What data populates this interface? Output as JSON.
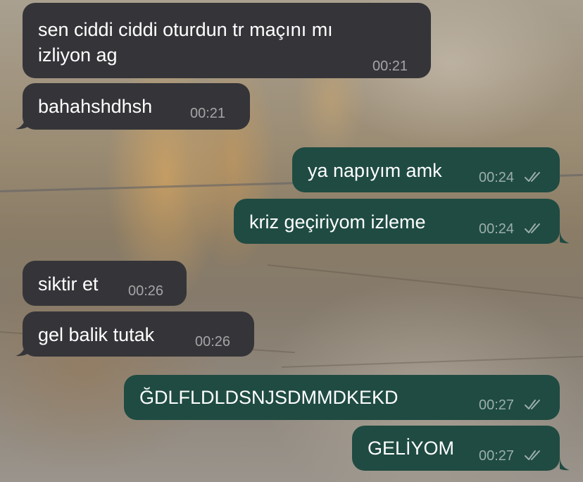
{
  "messages": [
    {
      "direction": "in",
      "lines": [
        "sen ciddi ciddi oturdun tr maçını mı",
        "izliyon ag"
      ],
      "time": "00:21"
    },
    {
      "direction": "in",
      "lines": [
        "bahahshdhsh"
      ],
      "time": "00:21"
    },
    {
      "direction": "out",
      "lines": [
        "ya napıyım amk"
      ],
      "time": "00:24",
      "status_icon": "double-check-icon"
    },
    {
      "direction": "out",
      "lines": [
        "kriz geçiriyom izleme"
      ],
      "time": "00:24",
      "status_icon": "double-check-icon"
    },
    {
      "direction": "in",
      "lines": [
        "siktir et"
      ],
      "time": "00:26"
    },
    {
      "direction": "in",
      "lines": [
        "gel balik tutak"
      ],
      "time": "00:26"
    },
    {
      "direction": "out",
      "lines": [
        "ĞDLFLDLDSNJSDMMDKEKD"
      ],
      "time": "00:27",
      "status_icon": "double-check-icon"
    },
    {
      "direction": "out",
      "lines": [
        "GELİYOM"
      ],
      "time": "00:27",
      "status_icon": "double-check-icon"
    }
  ],
  "colors": {
    "incoming_bubble": "#353539",
    "outgoing_bubble": "#1f4b42",
    "message_text": "#ffffff",
    "timestamp_text": "#9a9a9a"
  }
}
